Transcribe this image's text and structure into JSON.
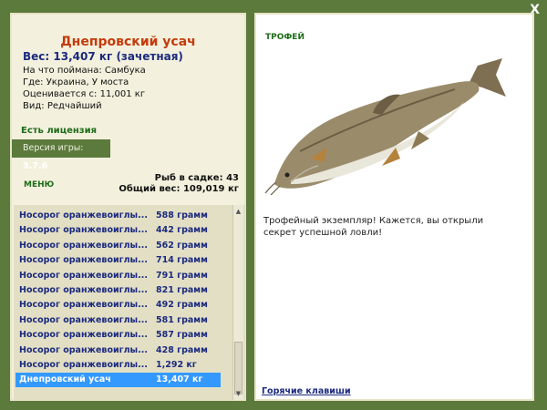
{
  "window": {
    "close_label": "X"
  },
  "fish": {
    "name": "Днепровский усач",
    "weight": "Вес: 13,407 кг (зачетная)",
    "bait": "На что поймана: Самбука",
    "location": "Где: Украина, У моста",
    "value": "Оценивается с: 11,001 кг",
    "rarity": "Вид: Редчайший"
  },
  "license": "Есть лицензия",
  "version": {
    "label": "Версия игры:",
    "value": "3.7.6"
  },
  "menu_label": "МЕНЮ",
  "stats": {
    "count": "Рыб в садке: 43",
    "total_weight": "Общий вес: 109,019 кг"
  },
  "catch_list": [
    {
      "name": "Носорог оранжевоиглы...",
      "weight": "588 грамм"
    },
    {
      "name": "Носорог оранжевоиглы...",
      "weight": "442 грамм"
    },
    {
      "name": "Носорог оранжевоиглы...",
      "weight": "562 грамм"
    },
    {
      "name": "Носорог оранжевоиглы...",
      "weight": "714 грамм"
    },
    {
      "name": "Носорог оранжевоиглы...",
      "weight": "791 грамм"
    },
    {
      "name": "Носорог оранжевоиглы...",
      "weight": "821 грамм"
    },
    {
      "name": "Носорог оранжевоиглы...",
      "weight": "492 грамм"
    },
    {
      "name": "Носорог оранжевоиглы...",
      "weight": "581 грамм"
    },
    {
      "name": "Носорог оранжевоиглы...",
      "weight": "587 грамм"
    },
    {
      "name": "Носорог оранжевоиглы...",
      "weight": "428 грамм"
    },
    {
      "name": "Носорог оранжевоиглы...",
      "weight": "1,292 кг"
    },
    {
      "name": "Днепровский усач",
      "weight": "13,407 кг",
      "selected": true
    }
  ],
  "trophy": {
    "title": "ТРОФЕЙ",
    "text": "Трофейный экземпляр! Кажется, вы открыли секрет успешной ловли!"
  },
  "hotkeys_label": "Горячие клавиши",
  "colors": {
    "background": "#5b7a3c",
    "accent_orange": "#c43b0c",
    "accent_blue": "#1b2a7e",
    "selection": "#3399ff",
    "green_text": "#1f6c1a"
  }
}
